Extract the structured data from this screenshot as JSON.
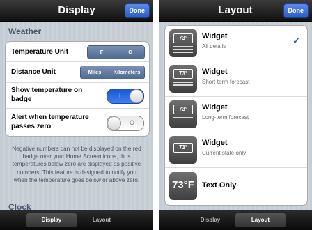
{
  "display": {
    "nav_title": "Display",
    "done_label": "Done",
    "section_weather": "Weather",
    "temperature_unit": {
      "label": "Temperature Unit",
      "options": [
        "F",
        "C"
      ]
    },
    "distance_unit": {
      "label": "Distance Unit",
      "options": [
        "Miles",
        "Kilometers"
      ]
    },
    "show_badge": {
      "label_line1": "Show temperature on",
      "label_line2": "badge",
      "on_mark": "I"
    },
    "alert_zero": {
      "label_line1": "Alert when temperature",
      "label_line2": "passes zero",
      "off_mark": "O"
    },
    "footnote": "Negative numbers can not be displayed on the red badge over your Home Screen icons, thus temperatures below zero are displayed as positive numbers. This feature is designed to notify you when the temperature goes below or above zero.",
    "section_clock": "Clock"
  },
  "layout": {
    "nav_title": "Layout",
    "done_label": "Done",
    "thumb_temp": "73°",
    "thumb_big_temp": "73°F",
    "items": [
      {
        "title": "Widget",
        "subtitle": "All details",
        "checked": true,
        "check_mark": "✓"
      },
      {
        "title": "Widget",
        "subtitle": "Short-term forecast"
      },
      {
        "title": "Widget",
        "subtitle": "Long-term forecast"
      },
      {
        "title": "Widget",
        "subtitle": "Current state only"
      },
      {
        "title": "Text Only"
      }
    ]
  },
  "tabs": [
    "Display",
    "Layout"
  ],
  "colors": {
    "accent": "#2a5cc8",
    "switch_on": "#1b56d1",
    "section_text": "#4c566c"
  }
}
